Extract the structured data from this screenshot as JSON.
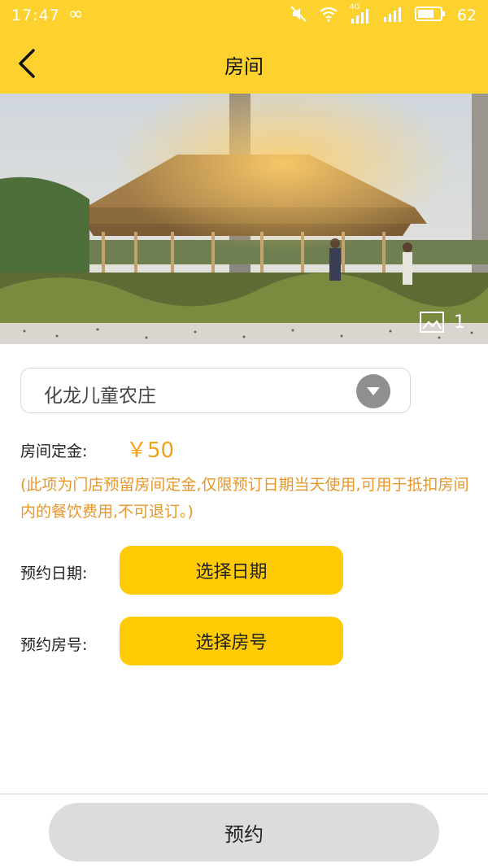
{
  "status_bar": {
    "time": "17:47",
    "loop_glyph": "∞",
    "network": "4G",
    "battery_level": "62",
    "icons": [
      "mute-icon",
      "wifi-icon",
      "signal-4g-icon",
      "signal-icon",
      "battery-icon"
    ]
  },
  "nav": {
    "title": "房间",
    "back_icon": "chevron-left-icon"
  },
  "gallery": {
    "counter": "1",
    "photo_icon": "image-icon"
  },
  "store": {
    "selected": "化龙儿童农庄",
    "dropdown_icon": "chevron-down-icon"
  },
  "deposit": {
    "label": "房间定金:",
    "value": "￥50",
    "note": "(此项为门店预留房间定金,仅限预订日期当天使用,可用于抵扣房间内的餐饮费用,不可退订。)"
  },
  "reserve_date": {
    "label": "预约日期:",
    "button": "选择日期"
  },
  "reserve_room": {
    "label": "预约房号:",
    "button": "选择房号"
  },
  "submit": {
    "label": "预约"
  },
  "colors": {
    "brand_yellow": "#fdd22f",
    "button_yellow": "#ffcb05",
    "price_orange": "#f0a21a",
    "note_orange": "#e8962a",
    "submit_gray": "#dcdcdc"
  }
}
